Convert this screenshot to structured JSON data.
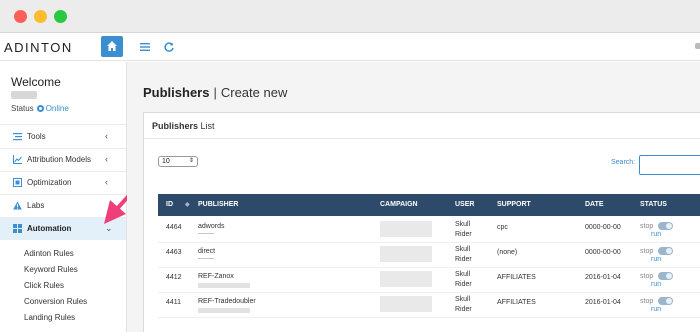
{
  "window": {
    "controls": [
      "close",
      "minimize",
      "maximize"
    ]
  },
  "topbar": {
    "logo": "ADINTON",
    "home_icon": "home-icon",
    "menu_icon": "menu-icon",
    "refresh_icon": "refresh-icon"
  },
  "sidebar": {
    "welcome": "Welcome",
    "status_label": "Status",
    "status_value": "Online",
    "items": [
      {
        "label": "Tools",
        "icon": "tools-icon",
        "chevron": "‹"
      },
      {
        "label": "Attribution Models",
        "icon": "chart-icon",
        "chevron": "‹"
      },
      {
        "label": "Optimization",
        "icon": "optimization-icon",
        "chevron": "‹"
      },
      {
        "label": "Labs",
        "icon": "warning-icon",
        "chevron": ""
      },
      {
        "label": "Automation",
        "icon": "grid-icon",
        "chevron": "⌄"
      }
    ],
    "subitems": [
      "Adinton Rules",
      "Keyword Rules",
      "Click Rules",
      "Conversion Rules",
      "Landing Rules"
    ]
  },
  "main": {
    "title": "Publishers",
    "separator": "|",
    "subtitle": "Create new",
    "panel_title_bold": "Publishers",
    "panel_title_rest": "List",
    "per_page": "10",
    "search_label": "Search:",
    "search_value": "",
    "columns": [
      "ID",
      "PUBLISHER",
      "CAMPAIGN",
      "USER",
      "SUPPORT",
      "DATE",
      "STATUS"
    ],
    "rows": [
      {
        "id": "4464",
        "publisher": "adwords",
        "pub_sub": "--------",
        "user_line1": "Skull",
        "user_line2": "Rider",
        "support": "cpc",
        "date": "0000-00-00",
        "stop": "stop",
        "run": "run"
      },
      {
        "id": "4463",
        "publisher": "direct",
        "pub_sub": "--------",
        "user_line1": "Skull",
        "user_line2": "Rider",
        "support": "(none)",
        "date": "0000-00-00",
        "stop": "stop",
        "run": "run"
      },
      {
        "id": "4412",
        "publisher": "REF-Zanox",
        "pub_sub": "",
        "user_line1": "Skull",
        "user_line2": "Rider",
        "support": "AFFILIATES",
        "date": "2016-01-04",
        "stop": "stop",
        "run": "run"
      },
      {
        "id": "4411",
        "publisher": "REF-Tradedoubler",
        "pub_sub": "",
        "user_line1": "Skull",
        "user_line2": "Rider",
        "support": "AFFILIATES",
        "date": "2016-01-04",
        "stop": "stop",
        "run": "run"
      }
    ]
  },
  "colors": {
    "accent": "#3b8fd0",
    "table_header": "#2d4a6a",
    "arrow": "#ef3e7a"
  }
}
